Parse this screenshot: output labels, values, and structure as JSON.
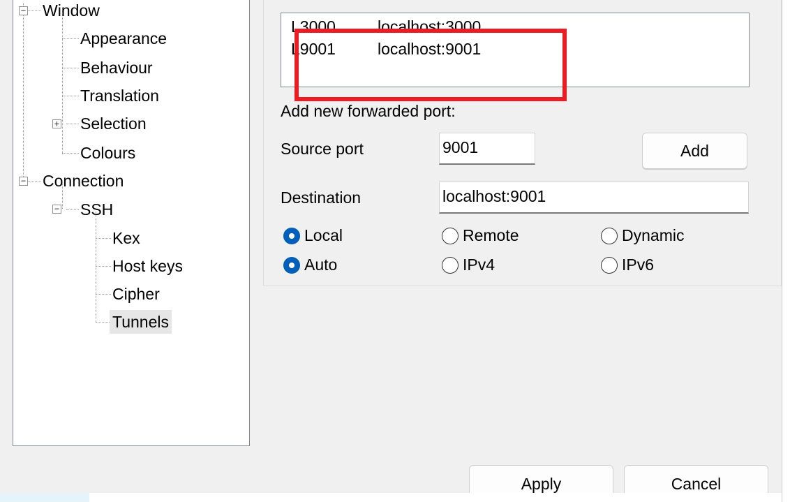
{
  "tree": {
    "window": "Window",
    "appearance": "Appearance",
    "behaviour": "Behaviour",
    "translation": "Translation",
    "selection": "Selection",
    "colours": "Colours",
    "connection": "Connection",
    "ssh": "SSH",
    "kex": "Kex",
    "host_keys": "Host keys",
    "cipher": "Cipher",
    "tunnels": "Tunnels",
    "expand_symbol": "+",
    "collapse_symbol": "−"
  },
  "tunnels": {
    "forwarded_ports": [
      {
        "name": "L3000",
        "destination": "localhost:3000"
      },
      {
        "name": "L9001",
        "destination": "localhost:9001"
      }
    ],
    "add_new_label": "Add new forwarded port:",
    "source_port_label": "Source port",
    "source_port_value": "9001",
    "add_button": "Add",
    "destination_label": "Destination",
    "destination_value": "localhost:9001",
    "direction": {
      "local": "Local",
      "remote": "Remote",
      "dynamic": "Dynamic",
      "selected": "local"
    },
    "protocol": {
      "auto": "Auto",
      "ipv4": "IPv4",
      "ipv6": "IPv6",
      "selected": "auto"
    }
  },
  "footer": {
    "apply": "Apply",
    "cancel": "Cancel"
  },
  "colors": {
    "accent": "#005fb8",
    "highlight": "#ec1c24"
  }
}
